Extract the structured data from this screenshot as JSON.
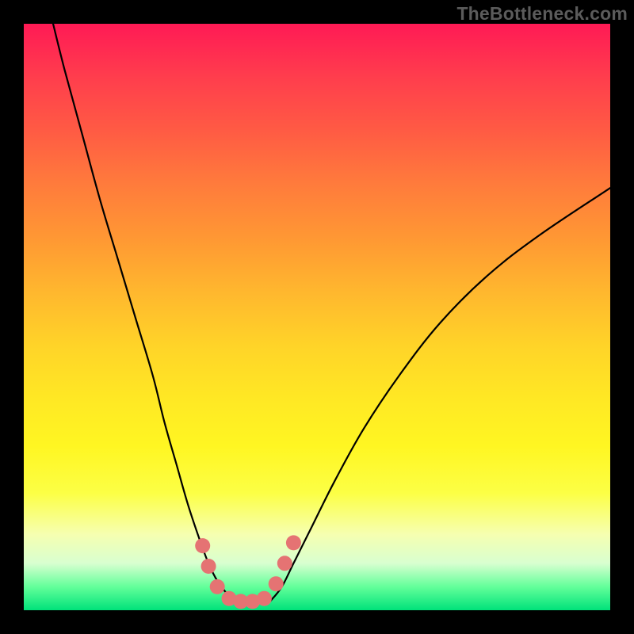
{
  "watermark": "TheBottleneck.com",
  "colors": {
    "background": "#000000",
    "curve": "#000000",
    "markers_fill": "#e57373",
    "markers_stroke": "#c94d4d",
    "gradient_top": "#ff1a55",
    "gradient_bottom": "#00e27a"
  },
  "chart_data": {
    "type": "line",
    "title": "",
    "xlabel": "",
    "ylabel": "",
    "xlim": [
      0,
      100
    ],
    "ylim": [
      0,
      100
    ],
    "grid": false,
    "legend_position": "none",
    "series": [
      {
        "name": "left-branch",
        "x": [
          5,
          7,
          10,
          13,
          16,
          19,
          22,
          24,
          26,
          28,
          30,
          31.5,
          33,
          34.5,
          36
        ],
        "y": [
          100,
          92,
          81,
          70,
          60,
          50,
          40,
          32,
          25,
          18,
          12,
          8,
          5,
          3,
          1.5
        ]
      },
      {
        "name": "right-branch",
        "x": [
          42,
          44,
          46,
          49,
          53,
          58,
          64,
          71,
          79,
          88,
          100
        ],
        "y": [
          1.5,
          4,
          8,
          14,
          22,
          31,
          40,
          49,
          57,
          64,
          72
        ]
      }
    ],
    "annotations": {
      "markers": [
        {
          "x": 30.5,
          "y": 11
        },
        {
          "x": 31.5,
          "y": 7.5
        },
        {
          "x": 33,
          "y": 4
        },
        {
          "x": 35,
          "y": 2
        },
        {
          "x": 37,
          "y": 1.5
        },
        {
          "x": 39,
          "y": 1.5
        },
        {
          "x": 41,
          "y": 2
        },
        {
          "x": 43,
          "y": 4.5
        },
        {
          "x": 44.5,
          "y": 8
        },
        {
          "x": 46,
          "y": 11.5
        }
      ]
    }
  }
}
